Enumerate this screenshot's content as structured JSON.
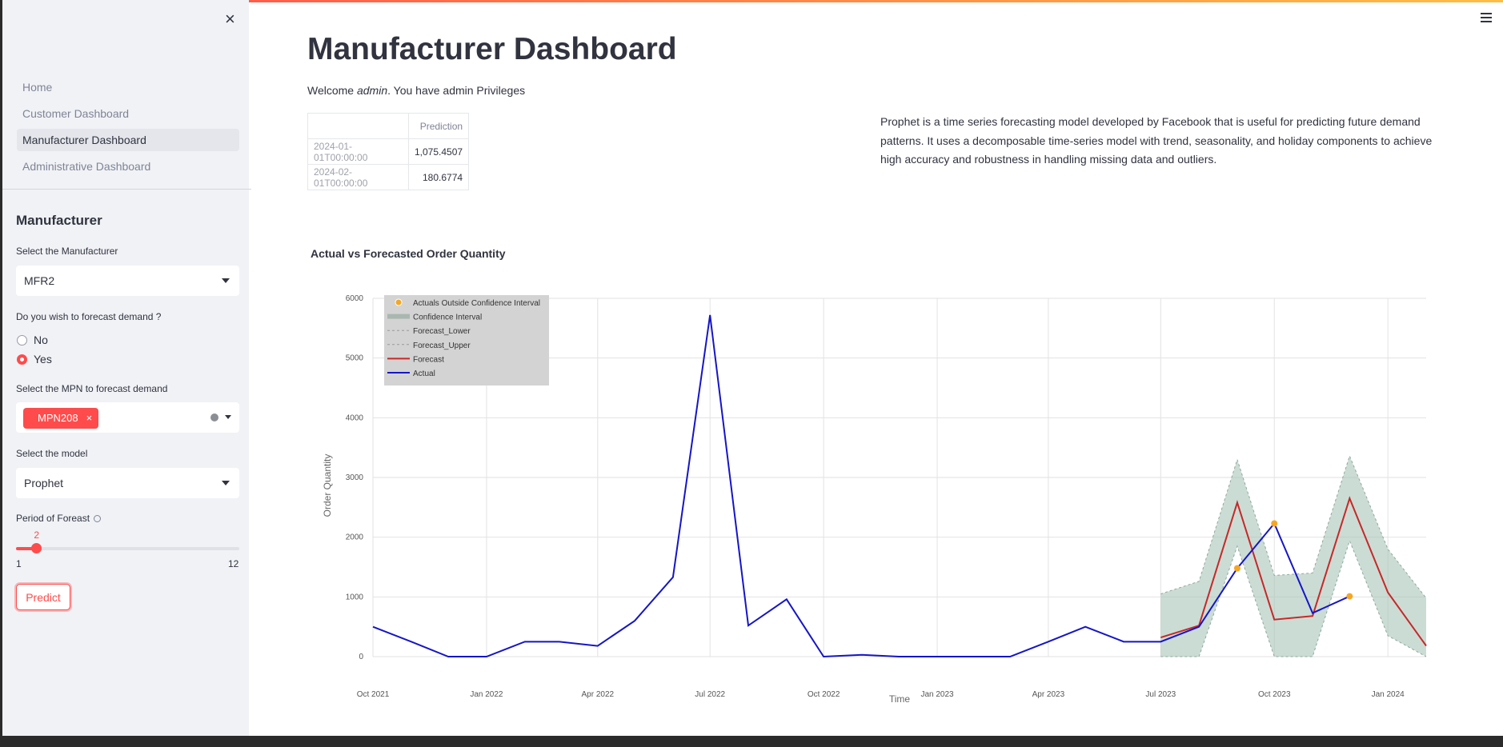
{
  "sidebar": {
    "nav": [
      "Home",
      "Customer Dashboard",
      "Manufacturer Dashboard",
      "Administrative Dashboard"
    ],
    "active_nav": "Manufacturer Dashboard",
    "section_title": "Manufacturer",
    "manufacturer_label": "Select the Manufacturer",
    "manufacturer_value": "MFR2",
    "forecast_question": "Do you wish to forecast demand ?",
    "radio_no": "No",
    "radio_yes": "Yes",
    "radio_selected": "Yes",
    "mpn_label": "Select the MPN to forecast demand",
    "mpn_chip": "MPN208",
    "chip_remove": "×",
    "model_label": "Select the model",
    "model_value": "Prophet",
    "period_label": "Period of Foreast",
    "period_value": "2",
    "period_min": "1",
    "period_max": "12",
    "predict_button": "Predict",
    "close_glyph": "×"
  },
  "main": {
    "title": "Manufacturer Dashboard",
    "welcome_prefix": "Welcome ",
    "welcome_user": "admin",
    "welcome_suffix": ". You have admin Privileges",
    "table": {
      "header": "Prediction",
      "rows": [
        {
          "index": "2024-01-01T00:00:00",
          "value": "1,075.4507"
        },
        {
          "index": "2024-02-01T00:00:00",
          "value": "180.6774"
        }
      ]
    },
    "description": "Prophet is a time series forecasting model developed by Facebook that is useful for predicting future demand patterns. It uses a decomposable time-series model with trend, seasonality, and holiday components to achieve high accuracy and robustness in handling missing data and outliers."
  },
  "icons": {
    "close": "close-icon",
    "menu": "hamburger-menu-icon",
    "clear": "clear-selection-icon"
  },
  "colors": {
    "accent": "#ff4b4b",
    "actual": "#1515c8",
    "forecast": "#c62828",
    "band": "#a9c4b7",
    "outside": "#f5a623"
  },
  "chart_data": {
    "type": "line",
    "title": "Actual vs Forecasted Order Quantity",
    "xlabel": "Time",
    "ylabel": "Order Quantity",
    "ylim": [
      0,
      6000
    ],
    "yticks": [
      0,
      1000,
      2000,
      3000,
      4000,
      5000,
      6000
    ],
    "xticks": [
      "2021-10-01",
      "2022-01-01",
      "2022-04-01",
      "2022-07-01",
      "2022-10-01",
      "2023-01-01",
      "2023-04-01",
      "2023-07-01",
      "2023-10-01",
      "2024-01-01"
    ],
    "xtick_labels": [
      "Oct 2021",
      "Jan 2022",
      "Apr 2022",
      "Jul 2022",
      "Oct 2022",
      "Jan 2023",
      "Apr 2023",
      "Jul 2023",
      "Oct 2023",
      "Jan 2024"
    ],
    "xlim": [
      "2021-10-01",
      "2024-02-01"
    ],
    "legend": {
      "placement": "top-left",
      "entries": [
        "Actuals Outside Confidence Interval",
        "Confidence Interval",
        "Forecast_Lower",
        "Forecast_Upper",
        "Forecast",
        "Actual"
      ]
    },
    "grid": true,
    "series": [
      {
        "name": "Actual",
        "x": [
          "2021-10-01",
          "2021-11-01",
          "2021-12-01",
          "2022-01-01",
          "2022-02-01",
          "2022-03-01",
          "2022-04-01",
          "2022-05-01",
          "2022-06-01",
          "2022-07-01",
          "2022-08-01",
          "2022-09-01",
          "2022-10-01",
          "2022-11-01",
          "2022-12-01",
          "2023-01-01",
          "2023-02-01",
          "2023-03-01",
          "2023-04-01",
          "2023-05-01",
          "2023-06-01",
          "2023-07-01",
          "2023-08-01",
          "2023-09-01",
          "2023-10-01",
          "2023-11-01",
          "2023-12-01"
        ],
        "values": [
          500,
          250,
          0,
          0,
          250,
          250,
          180,
          600,
          1330,
          5720,
          520,
          960,
          0,
          30,
          0,
          0,
          0,
          0,
          250,
          500,
          250,
          250,
          500,
          1480,
          2230,
          730,
          1010
        ]
      },
      {
        "name": "Forecast",
        "x": [
          "2023-07-01",
          "2023-08-01",
          "2023-09-01",
          "2023-10-01",
          "2023-11-01",
          "2023-12-01",
          "2024-01-01",
          "2024-02-01"
        ],
        "values": [
          320,
          520,
          2580,
          620,
          680,
          2650,
          1075,
          181
        ]
      },
      {
        "name": "Forecast_Lower",
        "x": [
          "2023-07-01",
          "2023-08-01",
          "2023-09-01",
          "2023-10-01",
          "2023-11-01",
          "2023-12-01",
          "2024-01-01",
          "2024-02-01"
        ],
        "values": [
          0,
          0,
          1850,
          0,
          0,
          1940,
          350,
          0
        ]
      },
      {
        "name": "Forecast_Upper",
        "x": [
          "2023-07-01",
          "2023-08-01",
          "2023-09-01",
          "2023-10-01",
          "2023-11-01",
          "2023-12-01",
          "2024-01-01",
          "2024-02-01"
        ],
        "values": [
          1050,
          1260,
          3300,
          1360,
          1400,
          3360,
          1800,
          980
        ]
      },
      {
        "name": "Actuals Outside Confidence Interval",
        "x": [
          "2023-09-01",
          "2023-10-01",
          "2023-12-01"
        ],
        "values": [
          1480,
          2230,
          1010
        ]
      }
    ]
  }
}
